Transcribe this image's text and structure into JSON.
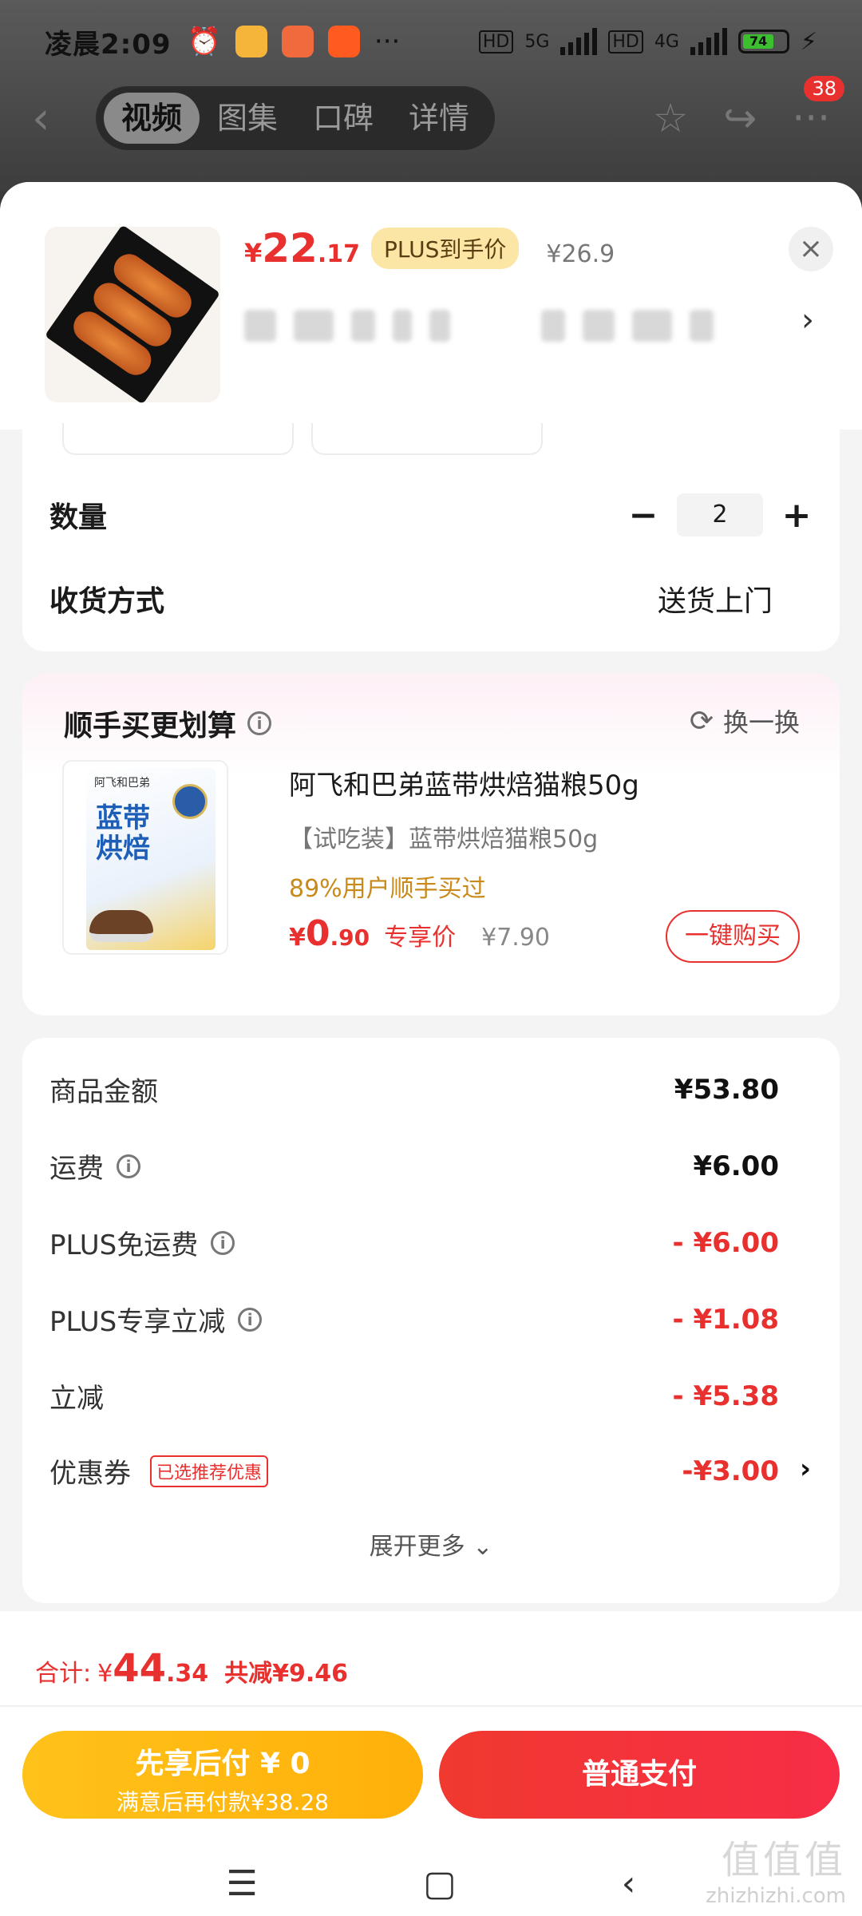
{
  "status_bar": {
    "time": "凌晨2:09",
    "more": "···",
    "network_1": "5G",
    "network_2": "4G",
    "hd": "HD",
    "battery": "74"
  },
  "nav": {
    "back": "‹",
    "tabs": [
      "视频",
      "图集",
      "口碑",
      "详情"
    ],
    "active_tab": "视频",
    "more": "···",
    "badge": "38"
  },
  "product": {
    "price_yen": "¥",
    "price_int": "22",
    "price_dec": ".17",
    "plus_tag": "PLUS到手价",
    "orig_price": "¥26.9",
    "close": "×",
    "chevron": "›"
  },
  "form": {
    "quantity_label": "数量",
    "minus": "−",
    "quantity": "2",
    "plus": "+",
    "delivery_label": "收货方式",
    "delivery_value": "送货上门"
  },
  "upsell": {
    "title": "顺手买更划算",
    "info": "i",
    "swap_label": "换一换",
    "swap_icon": "⟳",
    "pack_brand": "阿飞和巴弟",
    "pack_title": "蓝带烘焙",
    "name": "阿飞和巴弟蓝带烘焙猫粮50g",
    "sub": "【试吃装】蓝带烘焙猫粮50g",
    "bought": "89%用户顺手买过",
    "price_yen": "¥",
    "price_int": "0",
    "price_dec": ".90",
    "price_tag": "专享价",
    "orig_price": "¥7.90",
    "buy_button": "一键购买"
  },
  "summary": {
    "rows": [
      {
        "label": "商品金额",
        "value": "¥53.80"
      },
      {
        "label": "运费",
        "value": "¥6.00"
      },
      {
        "label": "PLUS免运费",
        "value": "- ¥6.00"
      },
      {
        "label": "PLUS专享立减",
        "value": "- ¥1.08"
      },
      {
        "label": "立减",
        "value": "- ¥5.38"
      },
      {
        "label": "优惠券",
        "value": "-¥3.00",
        "tag": "已选推荐优惠"
      }
    ],
    "info": "i",
    "chevron": "›",
    "expand": "展开更多 ⌄"
  },
  "footer": {
    "total_label": "合计:",
    "total_yen": "¥",
    "total_int": "44",
    "total_dec": ".34",
    "reduce": "共减¥9.46",
    "paylater_line1": "先享后付 ¥ 0",
    "paylater_line2": "满意后再付款¥38.28",
    "pay_button": "普通支付"
  },
  "system_nav": {
    "menu": "☰",
    "home": "▢",
    "back": "‹"
  },
  "watermark": {
    "big": "值值值",
    "small": "zhizhizhi.com"
  },
  "colors": {
    "accent_red": "#e8312f",
    "plus_gold": "#fbe6a6",
    "paylater_yellow": "#ffc21a"
  }
}
